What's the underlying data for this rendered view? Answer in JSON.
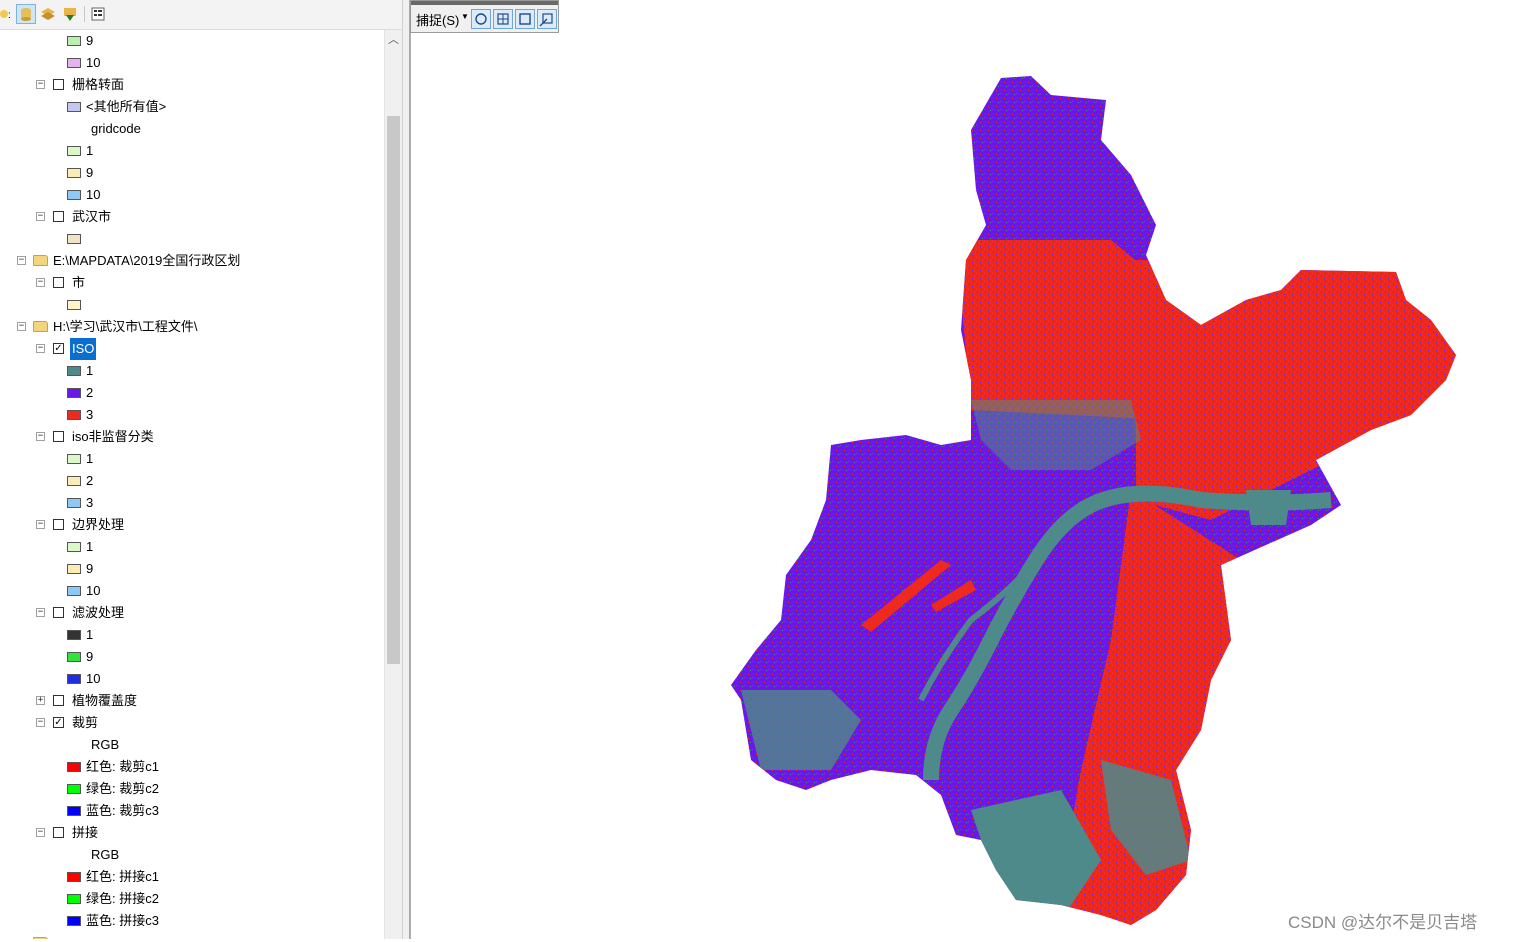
{
  "toc": {
    "rows": [
      {
        "text": "9"
      },
      {
        "text": "10"
      },
      {
        "text": "栅格转面"
      },
      {
        "text": "<其他所有值>"
      },
      {
        "text": "gridcode"
      },
      {
        "text": "1"
      },
      {
        "text": "9"
      },
      {
        "text": "10"
      },
      {
        "text": "武汉市"
      },
      {
        "text": ""
      },
      {
        "text": "E:\\MAPDATA\\2019全国行政区划"
      },
      {
        "text": "市"
      },
      {
        "text": ""
      },
      {
        "text": "H:\\学习\\武汉市\\工程文件\\"
      },
      {
        "text": "ISO"
      },
      {
        "text": "1"
      },
      {
        "text": "2"
      },
      {
        "text": "3"
      },
      {
        "text": "iso非监督分类"
      },
      {
        "text": "1"
      },
      {
        "text": "2"
      },
      {
        "text": "3"
      },
      {
        "text": "边界处理"
      },
      {
        "text": "1"
      },
      {
        "text": "9"
      },
      {
        "text": "10"
      },
      {
        "text": "滤波处理"
      },
      {
        "text": "1"
      },
      {
        "text": "9"
      },
      {
        "text": "10"
      },
      {
        "text": "植物覆盖度"
      },
      {
        "text": "裁剪"
      },
      {
        "text": "RGB"
      },
      {
        "text": "红色:    裁剪c1"
      },
      {
        "text": "绿色: 裁剪c2"
      },
      {
        "text": "蓝色:    裁剪c3"
      },
      {
        "text": "拼接"
      },
      {
        "text": "RGB"
      },
      {
        "text": "红色:    拼接c1"
      },
      {
        "text": "绿色: 拼接c2"
      },
      {
        "text": "蓝色:    拼接c3"
      }
    ]
  },
  "swatch_colors": {
    "light_green": "#b9f0b0",
    "lavender": "#e3b3f0",
    "periwinkle": "#c4c8ee",
    "pale_green": "#dcf7c8",
    "pale_yellow": "#fbebb5",
    "light_blue": "#8ec9f5",
    "beige": "#f2e3c4",
    "cream": "#fff5c8",
    "iso_teal": "#4e8a8a",
    "iso_purple": "#6a17ea",
    "iso_red": "#ee2a1f",
    "dark": "#333333",
    "bright_green": "#33e33a",
    "blue": "#1f2fe0",
    "red": "#ff0000",
    "green": "#00ff00",
    "pure_blue": "#0000ff"
  },
  "snapping": {
    "label": "捕捉(S)",
    "dropdown_icon": "caret-down-icon",
    "tools": [
      "point-snap-icon",
      "vertex-snap-icon",
      "edge-snap-icon",
      "end-snap-icon"
    ]
  },
  "watermark": "CSDN @达尔不是贝吉塔",
  "map_colors": {
    "teal": "#4e8a8a",
    "purple": "#6a17ea",
    "red": "#ee2a1f"
  }
}
